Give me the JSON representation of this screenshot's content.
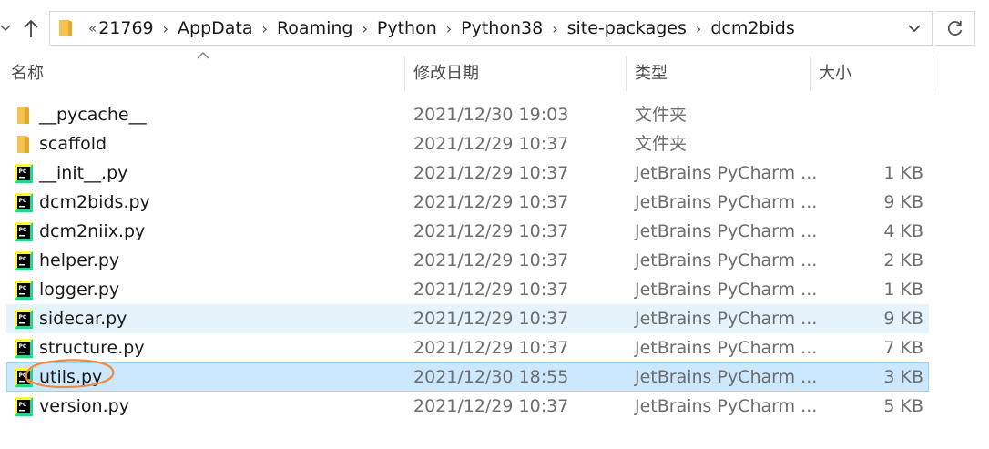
{
  "address": {
    "overflow": "«",
    "crumbs": [
      "21769",
      "AppData",
      "Roaming",
      "Python",
      "Python38",
      "site-packages",
      "dcm2bids"
    ]
  },
  "columns": {
    "name": "名称",
    "date": "修改日期",
    "type": "类型",
    "size": "大小"
  },
  "files": [
    {
      "name": "__pycache__",
      "date": "2021/12/30 19:03",
      "type": "文件夹",
      "size": "",
      "icon": "folder-icon"
    },
    {
      "name": "scaffold",
      "date": "2021/12/29 10:37",
      "type": "文件夹",
      "size": "",
      "icon": "folder-icon"
    },
    {
      "name": "__init__.py",
      "date": "2021/12/29 10:37",
      "type": "JetBrains PyCharm ...",
      "size": "1 KB",
      "icon": "pycharm-file-icon"
    },
    {
      "name": "dcm2bids.py",
      "date": "2021/12/29 10:37",
      "type": "JetBrains PyCharm ...",
      "size": "9 KB",
      "icon": "pycharm-file-icon"
    },
    {
      "name": "dcm2niix.py",
      "date": "2021/12/29 10:37",
      "type": "JetBrains PyCharm ...",
      "size": "4 KB",
      "icon": "pycharm-file-icon"
    },
    {
      "name": "helper.py",
      "date": "2021/12/29 10:37",
      "type": "JetBrains PyCharm ...",
      "size": "2 KB",
      "icon": "pycharm-file-icon"
    },
    {
      "name": "logger.py",
      "date": "2021/12/29 10:37",
      "type": "JetBrains PyCharm ...",
      "size": "1 KB",
      "icon": "pycharm-file-icon"
    },
    {
      "name": "sidecar.py",
      "date": "2021/12/29 10:37",
      "type": "JetBrains PyCharm ...",
      "size": "9 KB",
      "icon": "pycharm-file-icon"
    },
    {
      "name": "structure.py",
      "date": "2021/12/29 10:37",
      "type": "JetBrains PyCharm ...",
      "size": "7 KB",
      "icon": "pycharm-file-icon"
    },
    {
      "name": "utils.py",
      "date": "2021/12/30 18:55",
      "type": "JetBrains PyCharm ...",
      "size": "3 KB",
      "icon": "pycharm-file-icon"
    },
    {
      "name": "version.py",
      "date": "2021/12/29 10:37",
      "type": "JetBrains PyCharm ...",
      "size": "5 KB",
      "icon": "pycharm-file-icon"
    }
  ],
  "colors": {
    "hover_row": "#e5f3fb",
    "selected_row": "#cce8ff",
    "selected_border": "#99d1ff",
    "folder": "#f8c34d",
    "annotation": "#f08a3c"
  }
}
